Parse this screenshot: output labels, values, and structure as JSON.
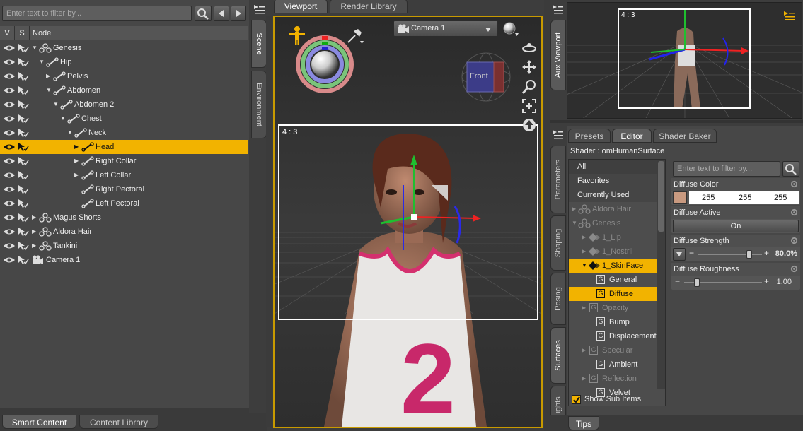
{
  "scene_panel": {
    "filter_placeholder": "Enter text to filter by...",
    "col_v": "V",
    "col_s": "S",
    "col_node": "Node",
    "nodes": [
      {
        "label": "Genesis",
        "expanded": true,
        "icon": "figure-icon"
      },
      {
        "label": "Hip",
        "expanded": true,
        "icon": "bone-icon"
      },
      {
        "label": "Pelvis",
        "expanded": false,
        "icon": "bone-icon"
      },
      {
        "label": "Abdomen",
        "expanded": true,
        "icon": "bone-icon"
      },
      {
        "label": "Abdomen 2",
        "expanded": true,
        "icon": "bone-icon"
      },
      {
        "label": "Chest",
        "expanded": true,
        "icon": "bone-icon"
      },
      {
        "label": "Neck",
        "expanded": true,
        "icon": "bone-icon"
      },
      {
        "label": "Head",
        "expanded": false,
        "icon": "bone-icon",
        "selected": true
      },
      {
        "label": "Right Collar",
        "expanded": false,
        "icon": "bone-icon"
      },
      {
        "label": "Left Collar",
        "expanded": false,
        "icon": "bone-icon"
      },
      {
        "label": "Right Pectoral",
        "icon": "bone-icon"
      },
      {
        "label": "Left Pectoral",
        "icon": "bone-icon"
      },
      {
        "label": "Magus Shorts",
        "expanded": false,
        "icon": "figure-icon"
      },
      {
        "label": "Aldora Hair",
        "expanded": false,
        "icon": "figure-icon"
      },
      {
        "label": "Tankini",
        "expanded": false,
        "icon": "figure-icon"
      },
      {
        "label": "Camera 1",
        "icon": "camera-icon"
      }
    ],
    "side_tabs": [
      "Scene",
      "Environment"
    ],
    "bottom_tabs": [
      "Smart Content",
      "Content Library"
    ]
  },
  "viewport": {
    "tabs": [
      "Viewport",
      "Render Library"
    ],
    "camera_select": "Camera 1",
    "aspect_label": "4 : 3",
    "cube_label": "Front"
  },
  "aux": {
    "tab": "Aux Viewport",
    "aspect_label": "4 : 3"
  },
  "surfaces": {
    "tabs": [
      "Presets",
      "Editor",
      "Shader Baker"
    ],
    "shader_label": "Shader : omHumanSurface",
    "filter_placeholder": "Enter text to filter by...",
    "side_tabs": [
      "Parameters",
      "Shaping",
      "Posing",
      "Surfaces",
      "Lights"
    ],
    "list": [
      {
        "label": "All"
      },
      {
        "label": "Favorites"
      },
      {
        "label": "Currently Used"
      },
      {
        "label": "Aldora Hair"
      },
      {
        "label": "Genesis"
      },
      {
        "label": "1_Lip"
      },
      {
        "label": "1_Nostril"
      },
      {
        "label": "1_SkinFace"
      },
      {
        "label": "General"
      },
      {
        "label": "Diffuse"
      },
      {
        "label": "Opacity"
      },
      {
        "label": "Bump"
      },
      {
        "label": "Displacement"
      },
      {
        "label": "Specular"
      },
      {
        "label": "Ambient"
      },
      {
        "label": "Reflection"
      },
      {
        "label": "Velvet"
      }
    ],
    "show_sub_items": "Show Sub Items",
    "tips": "Tips",
    "props": {
      "diffuse_color": {
        "title": "Diffuse Color",
        "r": "255",
        "g": "255",
        "b": "255"
      },
      "diffuse_active": {
        "title": "Diffuse Active",
        "value": "On"
      },
      "diffuse_strength": {
        "title": "Diffuse Strength",
        "value": "80.0%",
        "level": 0.8
      },
      "diffuse_roughness": {
        "title": "Diffuse Roughness",
        "value": "1.00",
        "level": 0.0
      }
    }
  },
  "colors": {
    "selection": "#f2b300",
    "panel": "#4a4a4a",
    "viewport_border": "#c89a00"
  }
}
